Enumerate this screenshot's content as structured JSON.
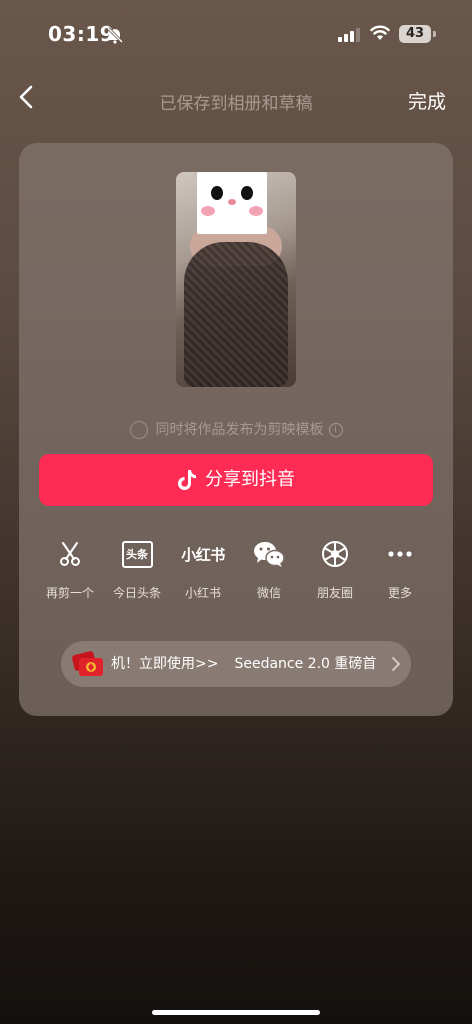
{
  "status_bar": {
    "time": "03:19",
    "battery": "43"
  },
  "nav": {
    "title": "已保存到相册和草稿",
    "done": "完成"
  },
  "template_option": {
    "label": "同时将作品发布为剪映模板",
    "info_icon": "i"
  },
  "share_button": {
    "label": "分享到抖音",
    "color": "#fe2c55"
  },
  "share_targets": [
    {
      "label": "再剪一个",
      "icon": "scissors-icon"
    },
    {
      "label": "今日头条",
      "icon_text": "头条"
    },
    {
      "label": "小红书",
      "icon_text": "小红书"
    },
    {
      "label": "微信",
      "icon": "wechat-icon"
    },
    {
      "label": "朋友圈",
      "icon": "moments-icon"
    },
    {
      "label": "更多",
      "icon": "more-icon"
    }
  ],
  "banner": {
    "text_part1": "机！立即使用>>",
    "text_part2": "Seedance 2.0 重磅首"
  }
}
